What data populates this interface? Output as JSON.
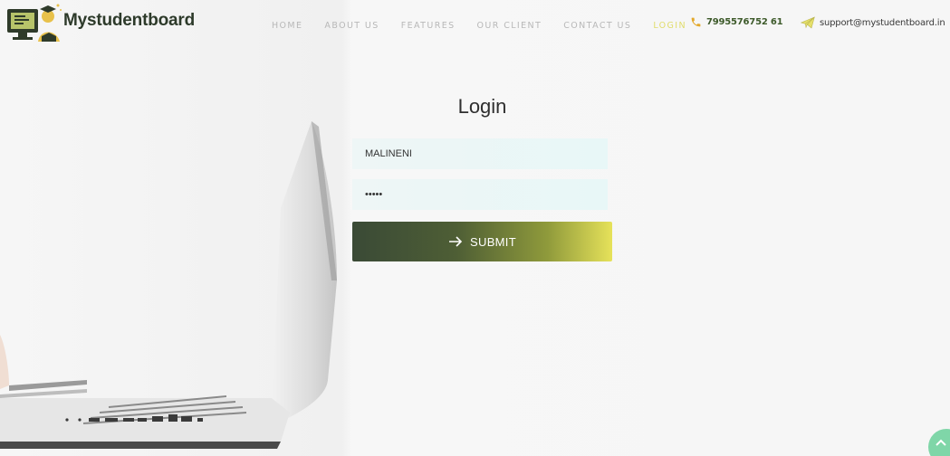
{
  "brand": {
    "name": "Mystudentboard"
  },
  "nav": {
    "items": [
      "HOME",
      "ABOUT US",
      "FEATURES",
      "OUR CLIENT",
      "CONTACT US",
      "LOGIN"
    ],
    "active": "LOGIN"
  },
  "contact": {
    "phone": "7995576752 61",
    "email": "support@mystudentboard.in"
  },
  "login": {
    "title": "Login",
    "username_value": "MALINENI",
    "password_value": "•••••",
    "submit_label": "SUBMIT"
  },
  "colors": {
    "accent_yellow": "#e0dc6a",
    "button_dark": "#3a4a36",
    "button_light": "#e6e25a",
    "scroll_top": "#7fd6a8"
  },
  "icons": {
    "phone": "phone-icon",
    "email": "paper-plane-icon",
    "submit": "arrow-right-icon",
    "scroll_top": "chevron-up-icon"
  }
}
